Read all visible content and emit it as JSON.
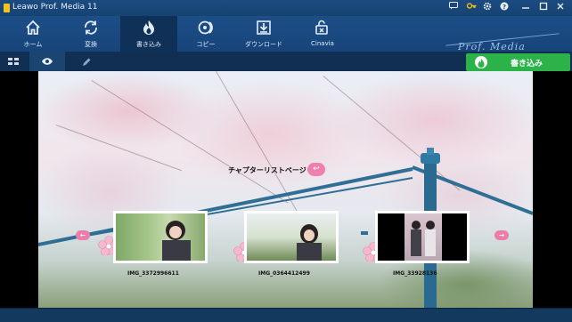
{
  "window": {
    "title": "Leawo Prof. Media 11",
    "brand": "Prof. Media"
  },
  "nav": {
    "items": [
      {
        "label": "ホーム",
        "icon": "home-icon"
      },
      {
        "label": "変換",
        "icon": "convert-icon"
      },
      {
        "label": "書き込み",
        "icon": "burn-flame-icon",
        "active": true
      },
      {
        "label": "コピー",
        "icon": "disc-copy-icon"
      },
      {
        "label": "ダウンロード",
        "icon": "download-icon"
      },
      {
        "label": "Cinavia",
        "icon": "cinavia-lock-icon"
      }
    ]
  },
  "toolbar": {
    "burn_label": "書き込み"
  },
  "menu": {
    "page_title": "チャプターリストページ",
    "return_icon": "↩",
    "prev_arrow": "←",
    "next_arrow": "→",
    "chapters": [
      {
        "caption": "IMG_3372996611"
      },
      {
        "caption": "IMG_0364412499"
      },
      {
        "caption": "IMG_33928136"
      }
    ]
  },
  "colors": {
    "accent_green": "#2bb34a",
    "menu_pink": "#ee7cab",
    "nav_blue": "#1c4f86"
  }
}
